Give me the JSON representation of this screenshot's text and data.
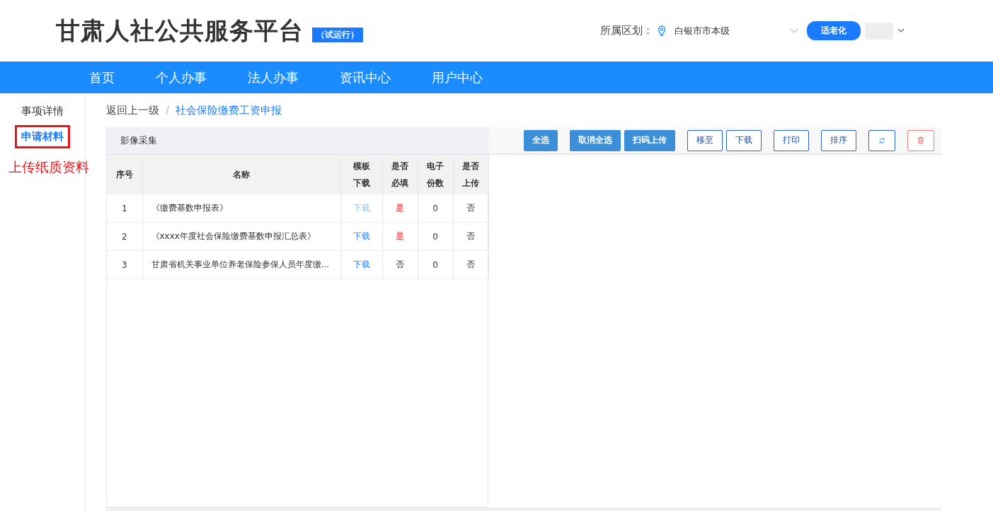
{
  "header": {
    "title": "甘肃人社公共服务平台",
    "badge": "（试运行）",
    "region_label": "所属区划：",
    "region_value": "白银市市本级",
    "elder_mode_button": "适老化"
  },
  "nav": [
    {
      "label": "首页",
      "selected": false
    },
    {
      "label": "个人办事",
      "selected": false
    },
    {
      "label": "法人办事",
      "selected": false
    },
    {
      "label": "资讯中心",
      "selected": false
    },
    {
      "label": "用户中心",
      "selected": false
    }
  ],
  "sidebar": {
    "items": [
      {
        "label": "事项详情",
        "selected": false
      },
      {
        "label": "申请材料",
        "selected": true
      }
    ],
    "annotation": "上传纸质资料"
  },
  "breadcrumb": {
    "back": "返回上一级",
    "separator": "/",
    "current": "社会保险缴费工资申报"
  },
  "panel_title": "影像采集",
  "toolbar": [
    {
      "kind": "primary",
      "label": "全选"
    },
    {
      "kind": "primary",
      "label": "取消全选"
    },
    {
      "kind": "primary",
      "label": "扫码上传"
    },
    {
      "kind": "outline",
      "label": "移至"
    },
    {
      "kind": "outline",
      "label": "下载"
    },
    {
      "kind": "outline",
      "label": "打印"
    },
    {
      "kind": "outline",
      "label": "排序"
    },
    {
      "kind": "refresh"
    },
    {
      "kind": "delete"
    }
  ],
  "table": {
    "columns": [
      "序号",
      "名称",
      "模板下载",
      "是否必填",
      "电子份数",
      "是否上传"
    ],
    "rows": [
      {
        "index": "1",
        "name": "《缴费基数申报表》",
        "download": "下载",
        "download_disabled": true,
        "required": "是",
        "required_flag": true,
        "copies": "0",
        "uploaded": "否"
      },
      {
        "index": "2",
        "name": "《xxxx年度社会保险缴费基数申报汇总表》",
        "download": "下载",
        "download_disabled": false,
        "required": "是",
        "required_flag": true,
        "copies": "0",
        "uploaded": "否"
      },
      {
        "index": "3",
        "name": "甘肃省机关事业单位养老保险参保人员年度缴...",
        "download": "下载",
        "download_disabled": false,
        "required": "否",
        "required_flag": false,
        "copies": "0",
        "uploaded": "否"
      }
    ]
  }
}
